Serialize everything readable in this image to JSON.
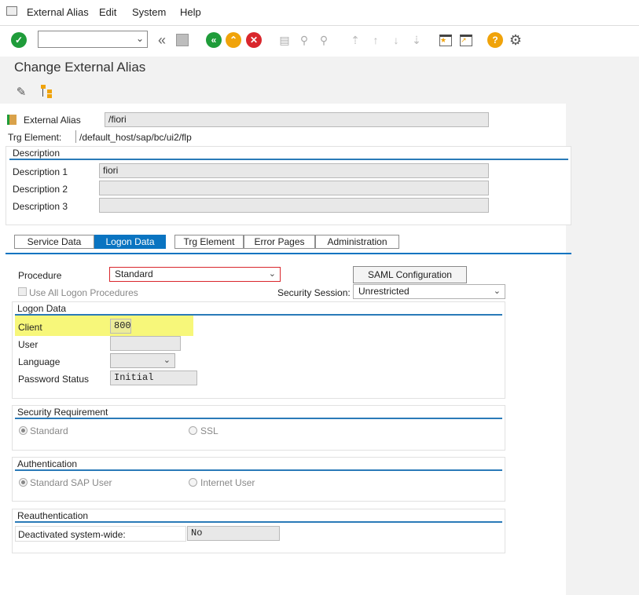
{
  "menu": {
    "external_alias": "External Alias",
    "edit": "Edit",
    "system": "System",
    "help": "Help"
  },
  "screen": {
    "title": "Change External Alias"
  },
  "header": {
    "external_alias_label": "External Alias",
    "external_alias_value": "/fiori",
    "trg_element_label": "Trg Element:",
    "trg_element_value": "/default_host/sap/bc/ui2/flp"
  },
  "description": {
    "title": "Description",
    "rows": [
      {
        "label": "Description 1",
        "value": "fiori"
      },
      {
        "label": "Description 2",
        "value": ""
      },
      {
        "label": "Description 3",
        "value": ""
      }
    ]
  },
  "tabs": [
    {
      "label": "Service Data",
      "active": false
    },
    {
      "label": "Logon Data",
      "active": true
    },
    {
      "label": "Trg Element",
      "active": false
    },
    {
      "label": "Error Pages",
      "active": false
    },
    {
      "label": "Administration",
      "active": false
    }
  ],
  "logon": {
    "procedure_label": "Procedure",
    "procedure_value": "Standard",
    "saml_button": "SAML Configuration",
    "use_all_label": "Use All Logon Procedures",
    "security_session_label": "Security Session:",
    "security_session_value": "Unrestricted",
    "group_title": "Logon Data",
    "client_label": "Client",
    "client_value": "800",
    "user_label": "User",
    "user_value": "",
    "language_label": "Language",
    "language_value": "",
    "password_status_label": "Password Status",
    "password_status_value": "Initial"
  },
  "security": {
    "title": "Security Requirement",
    "option_standard": "Standard",
    "option_ssl": "SSL",
    "selected": "Standard"
  },
  "authentication": {
    "title": "Authentication",
    "option_standard": "Standard SAP User",
    "option_internet": "Internet User",
    "selected": "Standard SAP User"
  },
  "reauth": {
    "title": "Reauthentication",
    "deactivated_label": "Deactivated system-wide:",
    "deactivated_value": "No"
  },
  "colors": {
    "accent_blue": "#0a74c1",
    "highlight_yellow": "#f7f77a",
    "green_check": "#1f9c3a",
    "orange": "#f0a30a",
    "red": "#d9262c"
  }
}
